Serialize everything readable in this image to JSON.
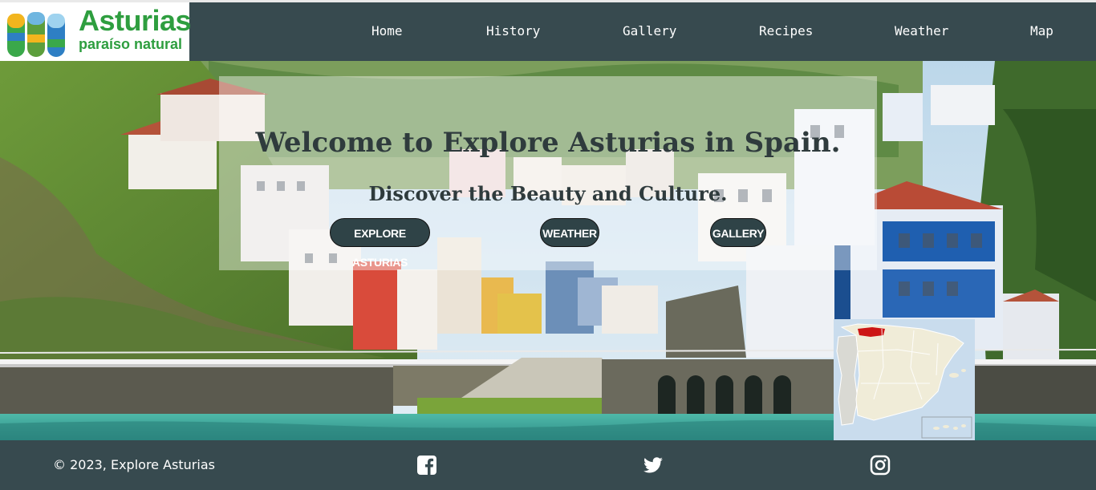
{
  "brand": {
    "title": "Asturias",
    "subtitle": "paraíso natural",
    "color": "#2e9e3f"
  },
  "nav": {
    "items": [
      {
        "label": "Home"
      },
      {
        "label": "History"
      },
      {
        "label": "Gallery"
      },
      {
        "label": "Recipes"
      },
      {
        "label": "Weather"
      },
      {
        "label": "Map"
      }
    ]
  },
  "hero": {
    "heading": "Welcome to Explore Asturias in Spain.",
    "subheading": "Discover the Beauty and Culture.",
    "buttons": [
      {
        "label": "EXPLORE ASTURIAS"
      },
      {
        "label": "WEATHER"
      },
      {
        "label": "GALLERY"
      }
    ]
  },
  "footer": {
    "copyright": "© 2023, Explore Asturias",
    "social_icons": [
      "facebook-icon",
      "twitter-icon",
      "instagram-icon"
    ]
  },
  "colors": {
    "header_bg": "#374a4f",
    "button_bg": "#2f4347",
    "text_dark": "#2f3b3d",
    "highlight_region": "#cc1515"
  }
}
